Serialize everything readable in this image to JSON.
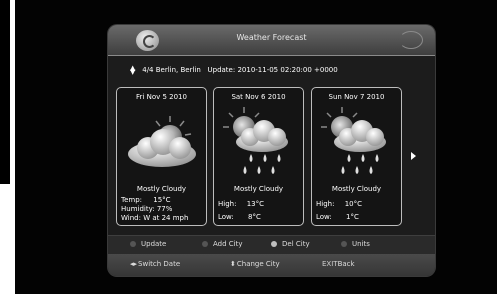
{
  "header": {
    "title": "Weather Forecast"
  },
  "location": {
    "index": "4/4",
    "city": "Berlin, Berlin",
    "update_label": "Update:",
    "update_value": "2010-11-05 02:20:00 +0000"
  },
  "forecast": [
    {
      "date": "Fri Nov  5 2010",
      "condition": "Mostly Cloudy",
      "line1_label": "Temp:",
      "line1_value": "15°C",
      "line2_label": "Humidity:",
      "line2_value": "77%",
      "line3_label": "Wind:",
      "line3_value": "W at 24 mph",
      "icon": "partly-cloudy-icon"
    },
    {
      "date": "Sat Nov  6 2010",
      "condition": "Mostly Cloudy",
      "line1_label": "High:",
      "line1_value": "13°C",
      "line2_label": "Low:",
      "line2_value": "8°C",
      "icon": "rain-sun-icon"
    },
    {
      "date": "Sun Nov  7 2010",
      "condition": "Mostly Cloudy",
      "line1_label": "High:",
      "line1_value": "10°C",
      "line2_label": "Low:",
      "line2_value": "1°C",
      "icon": "rain-sun-icon"
    }
  ],
  "buttons": [
    {
      "label": "Update",
      "color": "#555555"
    },
    {
      "label": "Add City",
      "color": "#555555"
    },
    {
      "label": "Del City",
      "color": "#bfbfbf"
    },
    {
      "label": "Units",
      "color": "#555555"
    }
  ],
  "navigation": {
    "switch_date": "Switch Date",
    "change_city": "Change City",
    "exit_key": "EXIT",
    "exit_label": "Back"
  },
  "colors": {
    "panel": "#1c1c1c",
    "header": "#5a5a5a",
    "text": "#ffffff"
  }
}
